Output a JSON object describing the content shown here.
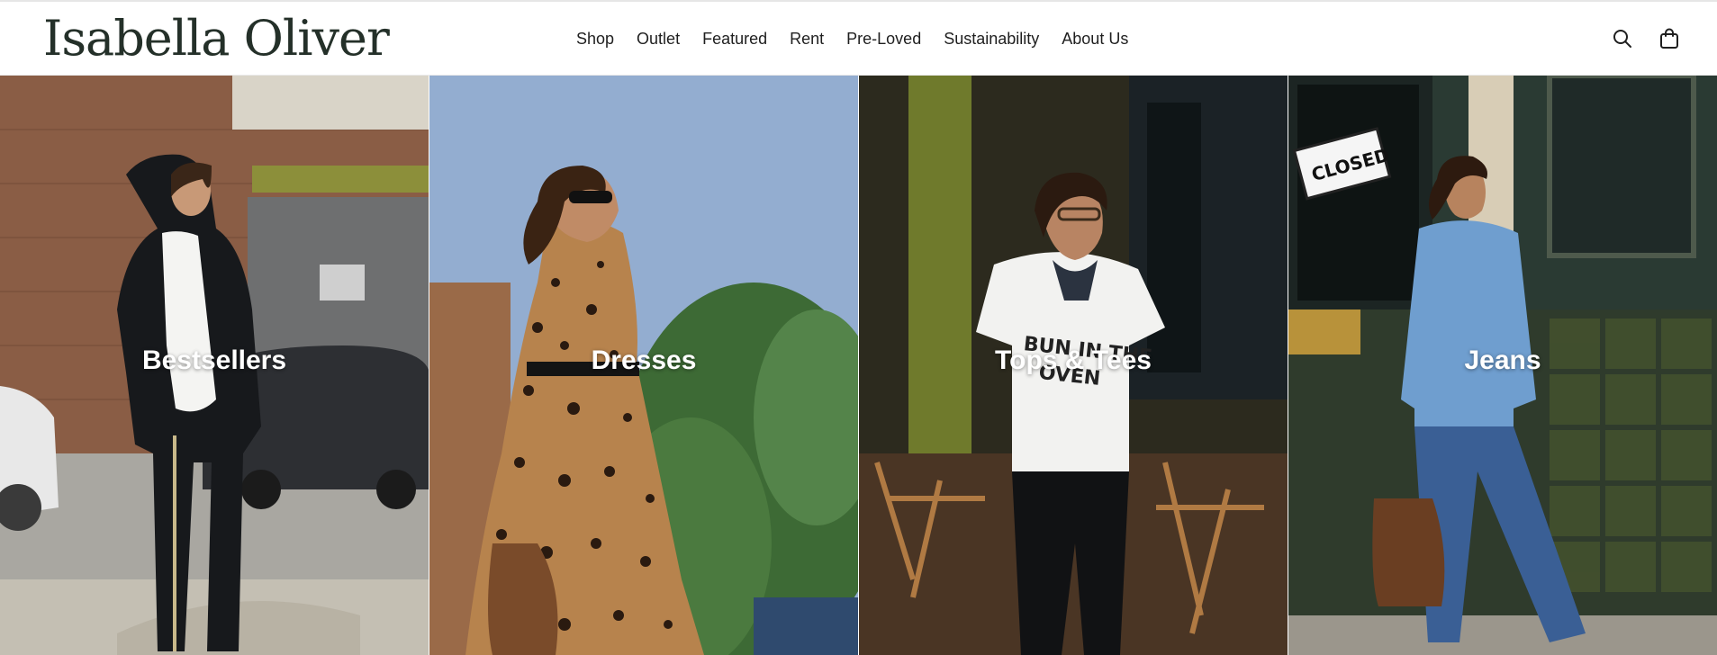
{
  "brand": {
    "logo_text": "Isabella Oliver"
  },
  "nav": {
    "items": [
      {
        "label": "Shop"
      },
      {
        "label": "Outlet"
      },
      {
        "label": "Featured"
      },
      {
        "label": "Rent"
      },
      {
        "label": "Pre-Loved"
      },
      {
        "label": "Sustainability"
      },
      {
        "label": "About Us"
      }
    ]
  },
  "icons": {
    "search": "search-icon",
    "bag": "shopping-bag-icon"
  },
  "tiles": [
    {
      "label": "Bestsellers"
    },
    {
      "label": "Dresses"
    },
    {
      "label": "Tops & Tees"
    },
    {
      "label": "Jeans"
    }
  ],
  "colors": {
    "logo": "#243029",
    "nav_text": "#1f1f1f",
    "tile_label": "#ffffff"
  }
}
